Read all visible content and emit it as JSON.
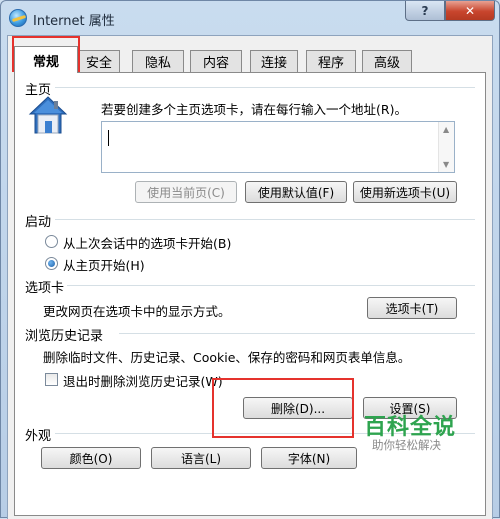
{
  "window": {
    "title": "Internet 属性",
    "help_label": "?",
    "close_label": "✕"
  },
  "tabs": [
    {
      "label": "常规",
      "active": true
    },
    {
      "label": "安全",
      "active": false
    },
    {
      "label": "隐私",
      "active": false
    },
    {
      "label": "内容",
      "active": false
    },
    {
      "label": "连接",
      "active": false
    },
    {
      "label": "程序",
      "active": false
    },
    {
      "label": "高级",
      "active": false
    }
  ],
  "home_page": {
    "group_title": "主页",
    "instruction": "若要创建多个主页选项卡，请在每行输入一个地址(R)。",
    "url_value": "",
    "use_current_label": "使用当前页(C)",
    "use_default_label": "使用默认值(F)",
    "use_new_tab_label": "使用新选项卡(U)",
    "icon": "house-icon"
  },
  "startup": {
    "group_title": "启动",
    "option_last_session": "从上次会话中的选项卡开始(B)",
    "option_home_page": "从主页开始(H)",
    "selected": "option_home_page"
  },
  "tabs_section": {
    "group_title": "选项卡",
    "description": "更改网页在选项卡中的显示方式。",
    "button_label": "选项卡(T)"
  },
  "history": {
    "group_title": "浏览历史记录",
    "description": "删除临时文件、历史记录、Cookie、保存的密码和网页表单信息。",
    "checkbox_label": "退出时删除浏览历史记录(W)",
    "checkbox_checked": false,
    "delete_label": "删除(D)...",
    "settings_label": "设置(S)"
  },
  "appearance": {
    "group_title": "外观",
    "colors_label": "颜色(O)",
    "languages_label": "语言(L)",
    "fonts_label": "字体(N)"
  },
  "watermark": {
    "title": "百科全说",
    "subtitle": "助你轻松解决"
  },
  "colors": {
    "highlight_red": "#e5322d",
    "watermark_green": "#2ea44f"
  }
}
